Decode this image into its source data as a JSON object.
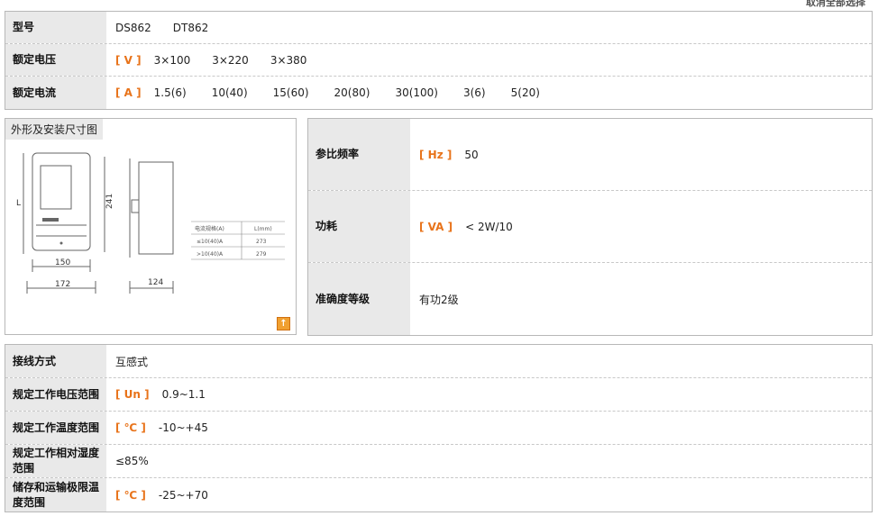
{
  "header": {
    "clear_all_label": "取消全部选择"
  },
  "top_table": {
    "model": {
      "label": "型号",
      "values": [
        "DS862",
        "DT862"
      ]
    },
    "voltage": {
      "label": "额定电压",
      "unit": "[ V ]",
      "values": [
        "3×100",
        "3×220",
        "3×380"
      ]
    },
    "current": {
      "label": "额定电流",
      "unit": "[ A ]",
      "values": [
        "1.5(6)",
        "10(40)",
        "15(60)",
        "20(80)",
        "30(100)",
        "3(6)",
        "5(20)"
      ]
    }
  },
  "outline_box": {
    "title": "外形及安装尺寸图",
    "drawing": {
      "dim_l": "L",
      "dim_241": "241",
      "dim_150": "150",
      "dim_172": "172",
      "dim_124": "124",
      "table_header_spec": "电流规格(A)",
      "table_header_l": "L(mm)",
      "table_rows": [
        {
          "spec": "≤10(40)A",
          "l": "273"
        },
        {
          "spec": ">10(40)A",
          "l": "279"
        }
      ]
    }
  },
  "right_table": {
    "frequency": {
      "label": "参比频率",
      "unit": "[ Hz ]",
      "value": "50"
    },
    "power": {
      "label": "功耗",
      "unit": "[ VA ]",
      "value": "< 2W/10"
    },
    "accuracy": {
      "label": "准确度等级",
      "value": "有功2级"
    }
  },
  "bottom_table": {
    "wiring": {
      "label": "接线方式",
      "value": "互感式"
    },
    "work_voltage": {
      "label": "规定工作电压范围",
      "unit": "[ Un ]",
      "value": "0.9~1.1"
    },
    "work_temp": {
      "label": "规定工作温度范围",
      "unit": "[ ℃ ]",
      "value": "-10~+45"
    },
    "humidity": {
      "label": "规定工作相对湿度范围",
      "value": "≤85%"
    },
    "storage_temp": {
      "label": "储存和运输极限温度范围",
      "unit": "[ ℃ ]",
      "value": "-25~+70"
    }
  },
  "colors": {
    "unit_accent": "#e8731a",
    "label_bg": "#e9e9e9",
    "border": "#b8b8b8"
  }
}
